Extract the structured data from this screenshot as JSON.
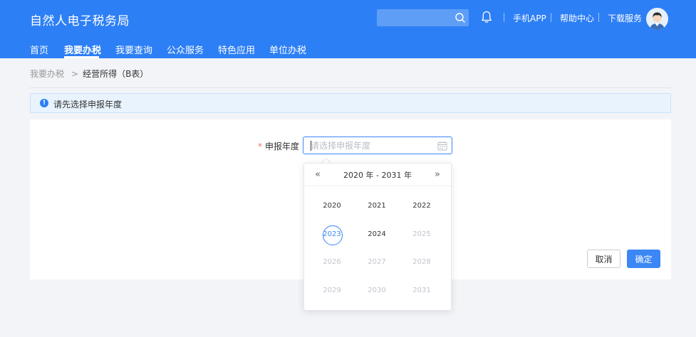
{
  "header": {
    "app_title": "自然人电子税务局",
    "search_placeholder": "",
    "links": {
      "mobile_app": "手机APP",
      "help_center": "帮助中心",
      "download_service": "下载服务"
    }
  },
  "nav": {
    "items": [
      "首页",
      "我要办税",
      "我要查询",
      "公众服务",
      "特色应用",
      "单位办税"
    ],
    "active": "我要办税"
  },
  "breadcrumb": {
    "parent": "我要办税",
    "separator": ">",
    "current": "经营所得（B表）"
  },
  "alert": {
    "icon_glyph": "!",
    "text": "请先选择申报年度"
  },
  "form": {
    "required_mark": "*",
    "year_label": "申报年度",
    "year_placeholder": "请选择申报年度",
    "year_value": ""
  },
  "year_picker": {
    "prev_glyph": "«",
    "next_glyph": "»",
    "range_label": "2020 年 - 2031 年",
    "years": [
      {
        "label": "2020",
        "state": "enabled"
      },
      {
        "label": "2021",
        "state": "enabled"
      },
      {
        "label": "2022",
        "state": "enabled"
      },
      {
        "label": "2023",
        "state": "current"
      },
      {
        "label": "2024",
        "state": "enabled"
      },
      {
        "label": "2025",
        "state": "disabled"
      },
      {
        "label": "2026",
        "state": "disabled"
      },
      {
        "label": "2027",
        "state": "disabled"
      },
      {
        "label": "2028",
        "state": "disabled"
      },
      {
        "label": "2029",
        "state": "disabled"
      },
      {
        "label": "2030",
        "state": "disabled"
      },
      {
        "label": "2031",
        "state": "disabled"
      }
    ]
  },
  "buttons": {
    "cancel": "取消",
    "confirm": "确定"
  },
  "colors": {
    "brand_blue": "#2d7ff5",
    "primary": "#3b87f5",
    "required_red": "#f56c6c"
  }
}
